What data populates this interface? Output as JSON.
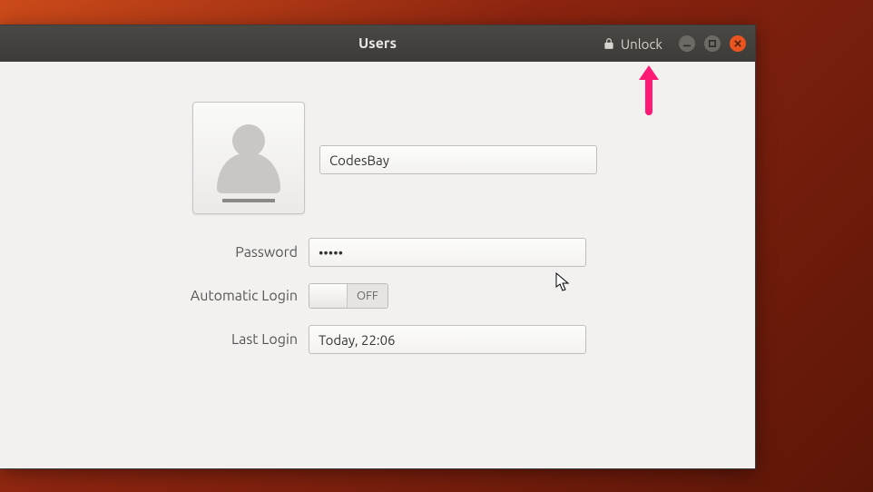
{
  "window": {
    "title": "Users",
    "unlock_label": "Unlock"
  },
  "user": {
    "name": "CodesBay",
    "password_masked": "•••••",
    "last_login": "Today, 22:06"
  },
  "labels": {
    "password": "Password",
    "auto_login": "Automatic Login",
    "last_login": "Last Login"
  },
  "toggle": {
    "auto_login_state": "OFF"
  }
}
